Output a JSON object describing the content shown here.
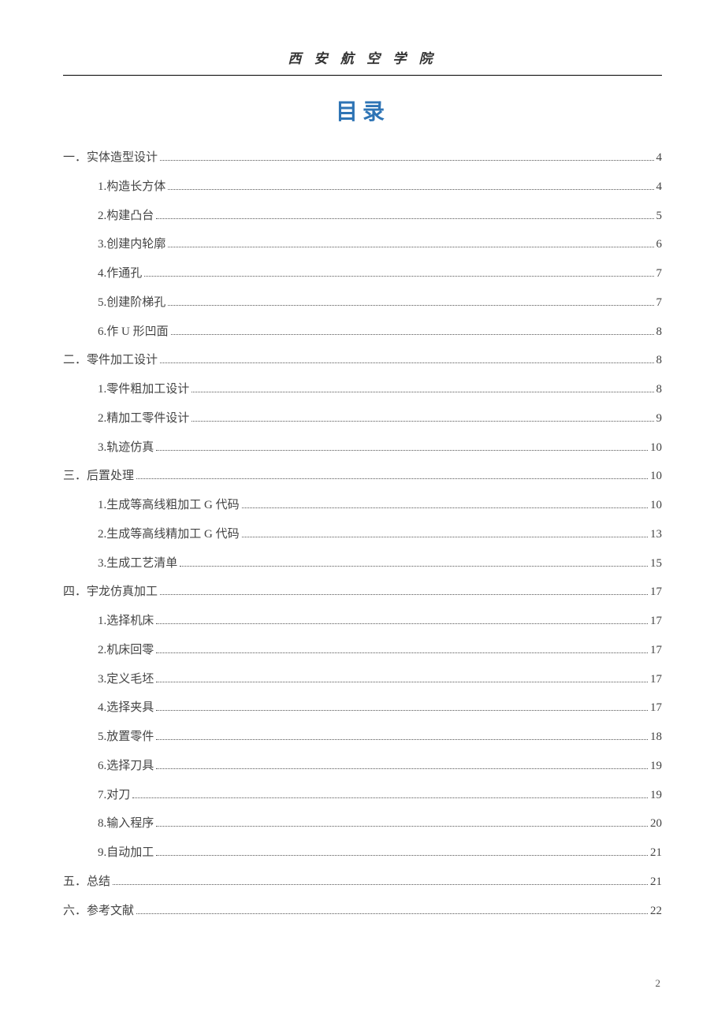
{
  "header": {
    "institution": "西 安 航 空 学 院"
  },
  "toc": {
    "heading": "目录",
    "entries": [
      {
        "level": 1,
        "label": "一．实体造型设计",
        "page": "4"
      },
      {
        "level": 2,
        "label": "1.构造长方体",
        "page": "4"
      },
      {
        "level": 2,
        "label": "2.构建凸台",
        "page": "5"
      },
      {
        "level": 2,
        "label": "3.创建内轮廓",
        "page": "6"
      },
      {
        "level": 2,
        "label": "4.作通孔",
        "page": "7"
      },
      {
        "level": 2,
        "label": "5.创建阶梯孔",
        "page": "7"
      },
      {
        "level": 2,
        "label": "6.作 U 形凹面",
        "page": "8"
      },
      {
        "level": 1,
        "label": "二．零件加工设计",
        "page": "8"
      },
      {
        "level": 2,
        "label": "1.零件粗加工设计",
        "page": "8"
      },
      {
        "level": 2,
        "label": "2.精加工零件设计",
        "page": "9"
      },
      {
        "level": 2,
        "label": "3.轨迹仿真",
        "page": "10"
      },
      {
        "level": 1,
        "label": "三．后置处理",
        "page": "10"
      },
      {
        "level": 2,
        "label": "1.生成等高线粗加工 G 代码",
        "page": "10"
      },
      {
        "level": 2,
        "label": "2.生成等高线精加工 G 代码",
        "page": "13"
      },
      {
        "level": 2,
        "label": "3.生成工艺清单",
        "page": "15"
      },
      {
        "level": 1,
        "label": "四．宇龙仿真加工",
        "page": "17"
      },
      {
        "level": 2,
        "label": "1.选择机床",
        "page": "17"
      },
      {
        "level": 2,
        "label": "2.机床回零",
        "page": "17"
      },
      {
        "level": 2,
        "label": "3.定义毛坯",
        "page": "17"
      },
      {
        "level": 2,
        "label": "4.选择夹具",
        "page": "17"
      },
      {
        "level": 2,
        "label": "5.放置零件",
        "page": "18"
      },
      {
        "level": 2,
        "label": "6.选择刀具",
        "page": "19"
      },
      {
        "level": 2,
        "label": "7.对刀",
        "page": "19"
      },
      {
        "level": 2,
        "label": "8.输入程序",
        "page": "20"
      },
      {
        "level": 2,
        "label": "9.自动加工",
        "page": "21"
      },
      {
        "level": 1,
        "label": "五．总结",
        "page": "21"
      },
      {
        "level": 1,
        "label": "六．参考文献",
        "page": "22"
      }
    ]
  },
  "footer": {
    "page_number": "2"
  }
}
